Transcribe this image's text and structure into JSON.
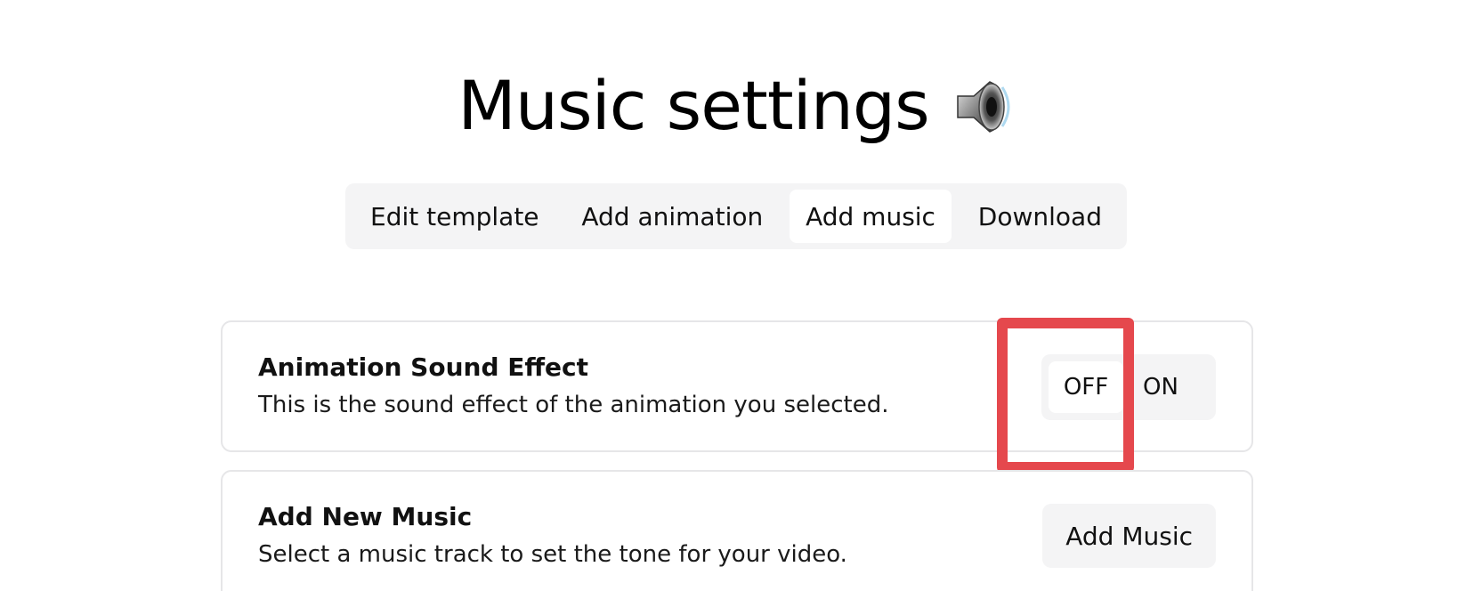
{
  "header": {
    "title": "Music settings",
    "title_icon": "speaker-icon"
  },
  "tabs": [
    {
      "label": "Edit template",
      "active": false
    },
    {
      "label": "Add animation",
      "active": false
    },
    {
      "label": "Add music",
      "active": true
    },
    {
      "label": "Download",
      "active": false
    }
  ],
  "sound_effect": {
    "title": "Animation Sound Effect",
    "description": "This is the sound effect of the animation you selected.",
    "toggle": {
      "off_label": "OFF",
      "on_label": "ON",
      "selected": "OFF"
    }
  },
  "new_music": {
    "title": "Add New Music",
    "description": "Select a music track to set the tone for your video.",
    "button_label": "Add Music"
  },
  "colors": {
    "highlight": "#e5484d",
    "tab_bar_bg": "#f4f4f5",
    "card_border": "#e6e6e8"
  }
}
